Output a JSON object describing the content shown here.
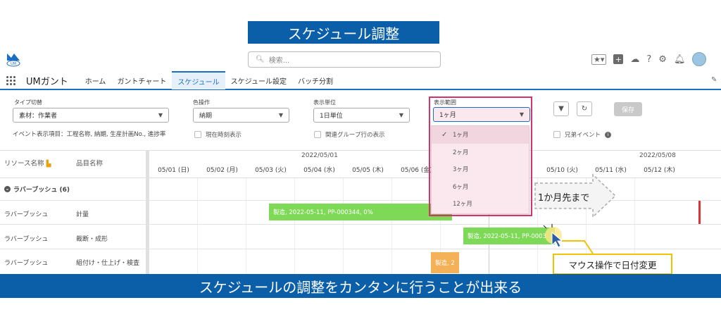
{
  "banner_title": "スケジュール調整",
  "bottom_banner": "スケジュールの調整をカンタンに行うことが出来る",
  "search": {
    "placeholder": "検索..."
  },
  "nav": {
    "app_name": "UMガント",
    "tabs": [
      {
        "label": "ホーム",
        "active": false
      },
      {
        "label": "ガントチャート",
        "active": false
      },
      {
        "label": "スケジュール",
        "active": true
      },
      {
        "label": "スケジュール設定",
        "active": false
      },
      {
        "label": "バッチ分割",
        "active": false
      }
    ]
  },
  "filters": {
    "type_label": "タイプ切替",
    "type_value": "素材：作業者",
    "color_label": "色操作",
    "color_value": "納期",
    "unit_label": "表示単位",
    "unit_value": "1日単位",
    "range_label": "表示範囲",
    "range_value": "1ヶ月",
    "save_label": "保存",
    "event_items": "イベント表示項目：工程名称, 納期, 生産計画No., 進捗率",
    "current_time": "現在時刻表示",
    "related_group": "関連グループ行の表示",
    "sibling_event": "兄弟イベント"
  },
  "range_options": [
    "1ヶ月",
    "2ヶ月",
    "3ヶ月",
    "6ヶ月",
    "12ヶ月"
  ],
  "range_selected_index": 0,
  "grid": {
    "resource_header": "リソース名称",
    "item_header": "品目名称",
    "week1_label": "2022/05/01",
    "week2_label": "2022/05/08",
    "dates": [
      "05/01 (日)",
      "05/02 (月)",
      "05/03 (火)",
      "05/04 (水)",
      "05/05 (木)",
      "05/06 (金)",
      "",
      "05/09 (月)",
      "05/10 (火)",
      "05/11 (水)",
      "05/12 (木)"
    ],
    "group_label": "ラバーブッシュ (6)",
    "rows": [
      {
        "resource": "ラバーブッシュ",
        "item": "計量"
      },
      {
        "resource": "ラバーブッシュ",
        "item": "裁断・成形"
      },
      {
        "resource": "ラバーブッシュ",
        "item": "組付け・仕上げ・検査"
      }
    ],
    "bars": [
      {
        "text": "製造, 2022-05-11, PP-000344, 0%",
        "color": "#7ed957"
      },
      {
        "text": "製造, 2022-05-11, PP-0003",
        "color": "#7ed957"
      },
      {
        "text": "製造, 2",
        "color": "#f4b157"
      }
    ]
  },
  "callouts": {
    "arrow_text": "1か月先まで",
    "mouse_text": "マウス操作で日付変更"
  }
}
